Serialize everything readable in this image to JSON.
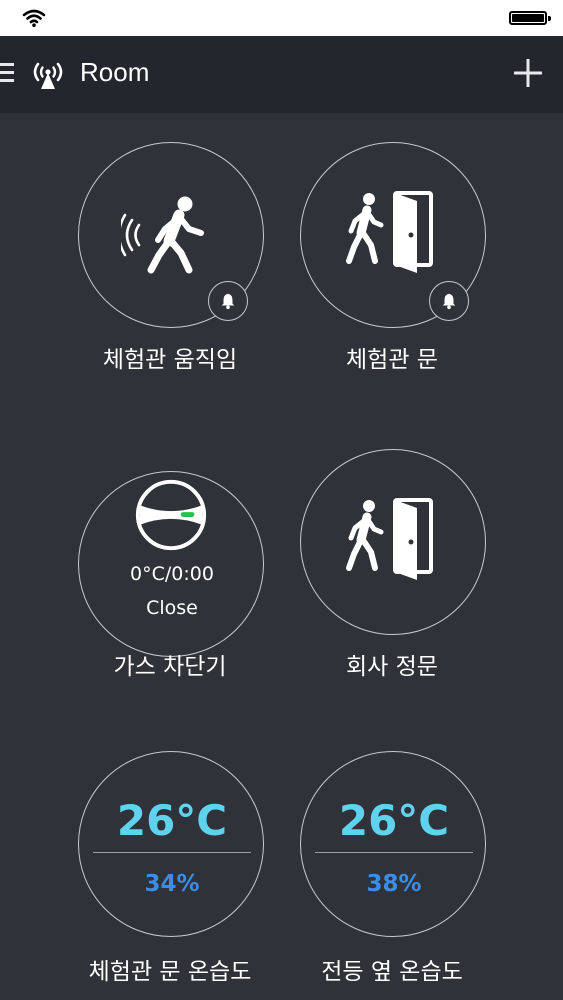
{
  "nav": {
    "title": "Room"
  },
  "devices": [
    {
      "label": "체험관 움직임",
      "type": "motion"
    },
    {
      "label": "체험관 문",
      "type": "door"
    },
    {
      "label": "가스 차단기",
      "type": "gas",
      "reading": "0°C/0:00",
      "state": "Close"
    },
    {
      "label": "회사 정문",
      "type": "door"
    },
    {
      "label": "체험관 문 온습도",
      "type": "thermo",
      "temperature": "26°C",
      "humidity": "34%"
    },
    {
      "label": "전등 옆 온습도",
      "type": "thermo",
      "temperature": "26°C",
      "humidity": "38%"
    }
  ],
  "colors": {
    "background": "#2f3239",
    "navbar": "#23262c",
    "temperature": "#5fd2ee",
    "humidity": "#3a8ee8",
    "gas_indicator": "#27c24c"
  }
}
